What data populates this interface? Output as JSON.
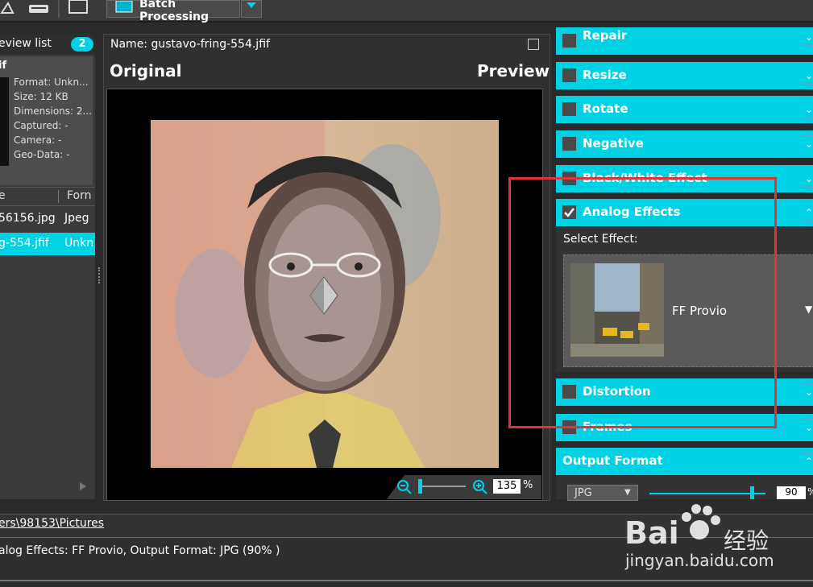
{
  "toolbar": {
    "batch_label": "Batch Processing"
  },
  "left": {
    "list_title": "eview list",
    "list_count": "2",
    "info_title": "if",
    "info": [
      "Format: Unkn...",
      "Size: 12 KB",
      "Dimensions: 2...",
      "Captured: -",
      "Camera: -",
      "Geo-Data: -"
    ],
    "columns": [
      "e",
      "Forn"
    ],
    "rows": [
      {
        "name": "56156.jpg",
        "format": "Jpeg"
      },
      {
        "name": "g-554.jfif",
        "format": "Unkn"
      }
    ]
  },
  "center": {
    "name": "Name: gustavo-fring-554.jfif",
    "original": "Original",
    "preview": "Preview",
    "zoom": "135",
    "zoom_unit": "%"
  },
  "right": {
    "sections": [
      {
        "title": "Repair",
        "checked": false
      },
      {
        "title": "Resize",
        "checked": false
      },
      {
        "title": "Rotate",
        "checked": false
      },
      {
        "title": "Negative",
        "checked": false
      },
      {
        "title": "Black/White Effect",
        "checked": false
      },
      {
        "title": "Analog Effects",
        "checked": true
      },
      {
        "title": "Distortion",
        "checked": false
      },
      {
        "title": "Frames",
        "checked": false
      }
    ],
    "select_effect_label": "Select Effect:",
    "effect_name": "FF Provio",
    "output_format_title": "Output Format",
    "format": "JPG",
    "quality": "90",
    "quality_unit": "%"
  },
  "bottom": {
    "path": "ers\\98153\\Pictures",
    "status": "alog Effects: FF Provio, Output Format: JPG (90% )"
  },
  "watermark": {
    "brand": "Bai",
    "brand_cn": "经验",
    "url": "jingyan.baidu.com"
  }
}
